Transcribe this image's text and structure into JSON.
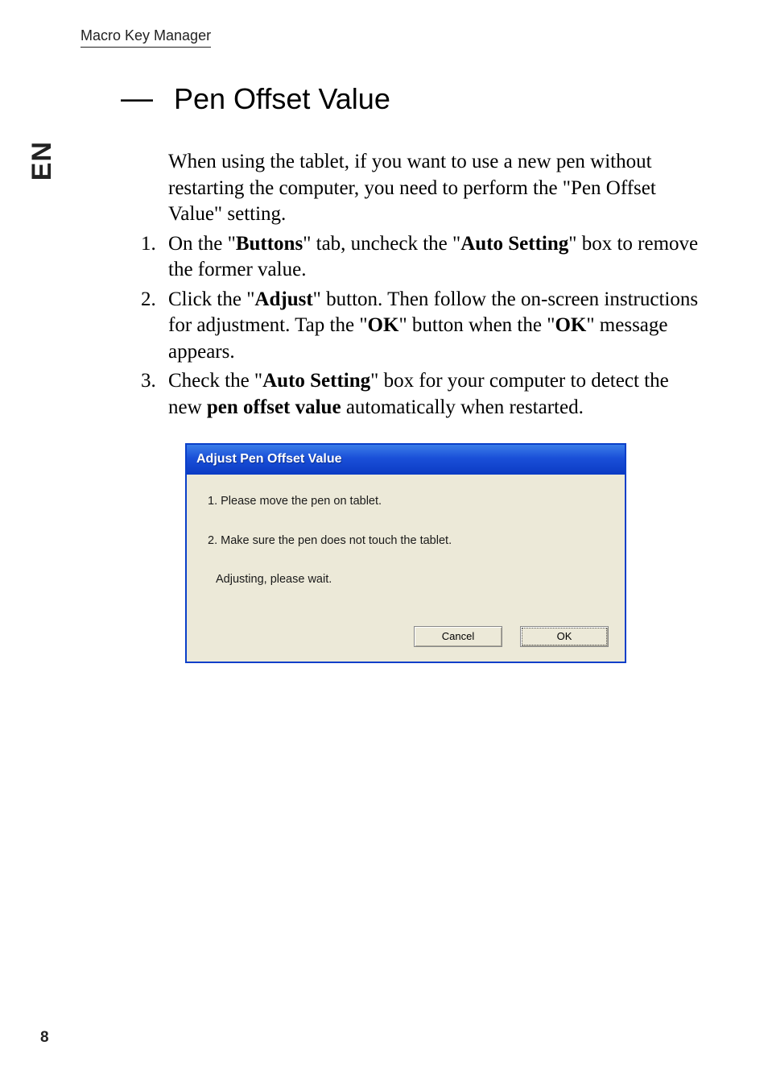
{
  "header": {
    "label": "Macro Key Manager"
  },
  "side": {
    "lang": "EN"
  },
  "section": {
    "dash": "—",
    "title": "Pen Offset Value",
    "intro": "When using the tablet, if you want to use a new pen without restarting the computer, you need to perform the \"Pen Offset Value\" setting.",
    "step1_pre": "1. ",
    "step1_a": "On the \"",
    "step1_b": "Buttons",
    "step1_c": "\" tab, uncheck the \"",
    "step1_d": "Auto Setting",
    "step1_e": "\" box to remove the former value.",
    "step2_pre": "2. ",
    "step2_a": "Click the \"",
    "step2_b": "Adjust",
    "step2_c": "\" button. Then follow the on-screen instructions for adjustment. Tap the \"",
    "step2_d": "OK",
    "step2_e": "\" button when the \"",
    "step2_f": "OK",
    "step2_g": "\" message appears.",
    "step3_pre": "3. ",
    "step3_a": "Check the \"",
    "step3_b": "Auto Setting",
    "step3_c": "\" box for your computer to detect the new ",
    "step3_d": "pen offset value",
    "step3_e": " automatically when restarted."
  },
  "dialog": {
    "title": "Adjust Pen Offset Value",
    "line1": "1. Please move the pen on tablet.",
    "line2": "2. Make sure the pen does not touch the tablet.",
    "line3": "Adjusting, please wait.",
    "cancel": "Cancel",
    "ok": "OK"
  },
  "page": {
    "number": "8"
  }
}
